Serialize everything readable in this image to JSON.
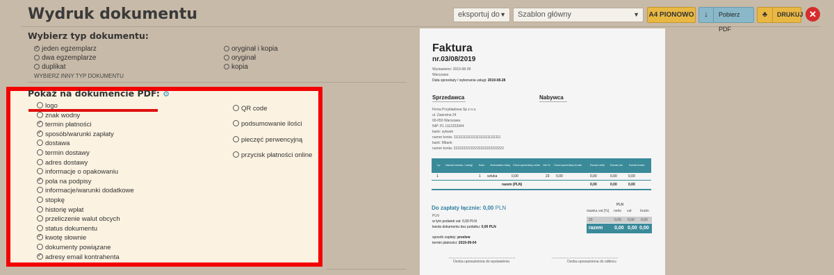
{
  "header": {
    "title": "Wydruk dokumentu"
  },
  "toolbar": {
    "export_select": "eksportuj do",
    "template_select": "Szablon główny",
    "orientation_button": "A4 PIONOWO",
    "download_pdf_button": "Pobierz PDF",
    "print_button": "DRUKUJ"
  },
  "doc_type": {
    "heading": "Wybierz typ dokumentu:",
    "options_left": [
      {
        "label": "jeden egzemplarz",
        "checked": true
      },
      {
        "label": "dwa egzemplarze",
        "checked": false
      },
      {
        "label": "duplikat",
        "checked": false
      }
    ],
    "options_right": [
      {
        "label": "oryginał i kopia",
        "checked": false
      },
      {
        "label": "oryginał",
        "checked": false
      },
      {
        "label": "kopia",
        "checked": false
      }
    ],
    "other_link": "WYBIERZ INNY TYP DOKUMENTU"
  },
  "show_on_pdf": {
    "heading": "Pokaż na dokumencie PDF:",
    "options_left": [
      {
        "label": "logo",
        "checked": false
      },
      {
        "label": "znak wodny",
        "checked": false
      },
      {
        "label": "termin płatności",
        "checked": true
      },
      {
        "label": "sposób/warunki zapłaty",
        "checked": true
      },
      {
        "label": "dostawa",
        "checked": false
      },
      {
        "label": "termin dostawy",
        "checked": false
      },
      {
        "label": "adres dostawy",
        "checked": false
      },
      {
        "label": "informacje o opakowaniu",
        "checked": false
      },
      {
        "label": "pola na podpisy",
        "checked": true
      },
      {
        "label": "informacje/warunki dodatkowe",
        "checked": false
      },
      {
        "label": "stopkę",
        "checked": false
      },
      {
        "label": "historię wpłat",
        "checked": false
      },
      {
        "label": "przeliczenie walut obcych",
        "checked": false
      },
      {
        "label": "status dokumentu",
        "checked": false
      },
      {
        "label": "kwotę słownie",
        "checked": true
      },
      {
        "label": "dokumenty powiązane",
        "checked": false
      },
      {
        "label": "adresy email kontrahenta",
        "checked": true
      }
    ],
    "options_right": [
      {
        "label": "QR code",
        "checked": false
      },
      {
        "label": "podsumowanie ilości",
        "checked": false
      },
      {
        "label": "pieczęć perwencyjną",
        "checked": false
      },
      {
        "label": "przycisk płatności online",
        "checked": false
      }
    ]
  },
  "invoice": {
    "title": "Faktura",
    "number": "nr.03/08/2019",
    "issued": "Wystawiono: 2019-08-28",
    "place": "Warszawa",
    "sale_date_label": "Data sprzedaży / wykonania usługi:",
    "sale_date": "2019-08-28",
    "seller_heading": "Sprzedawca",
    "buyer_heading": "Nabywca",
    "seller_lines": [
      "Firma Przykładowa Sp z o.o.",
      "ul. Zawrotna 24",
      "00-050 Warszawa",
      "NIP: PL 1112223344",
      "bank: sykwek",
      "numer konta: 1111111111111111111111111111",
      "bank: Mbank",
      "numer konta: 22222222222222222222222222"
    ],
    "table_headers": [
      "Lp",
      "Nazwa towaru / usługi",
      "Ilość",
      "Jednostka miary",
      "Cena sprzedaży netto",
      "Vat %",
      "Cena sprzedaży brutto",
      "Kwota netto",
      "Kwota vat",
      "Kwota brutto"
    ],
    "row": [
      "1",
      "1",
      "sztuka",
      "0,00",
      "23",
      "0,00",
      "0,00",
      "0,00",
      "0,00"
    ],
    "row_total": [
      "razem (PLN)",
      "0,00",
      "0,00",
      "0,00"
    ],
    "to_pay_label": "Do zapłaty łącznie:",
    "to_pay_value": "0,00",
    "to_pay_currency": "PLN",
    "currency_line": "PLN",
    "vat_included": "w tym podatek vat:",
    "vat_included_val": "0,00 PLN",
    "net_line": "kwota dokumentu bez podatku:",
    "net_line_val": "0,00 PLN",
    "payment_method_label": "sposób zapłaty:",
    "payment_method": "przelew",
    "payment_due_label": "termin płatności:",
    "payment_due": "2019-09-04",
    "summary_currency": "PLN",
    "summary_headers": [
      "stawka vat [%]",
      "netto",
      "vat",
      "brutto"
    ],
    "summary_row": [
      "23",
      "0,00",
      "0,00",
      "0,00"
    ],
    "summary_total": [
      "razem",
      "0,00",
      "0,00",
      "0,00"
    ],
    "sign_issuer": "Osoba upoważniona do wystawienia",
    "sign_receiver": "Osoba upoważniona do odbioru"
  }
}
